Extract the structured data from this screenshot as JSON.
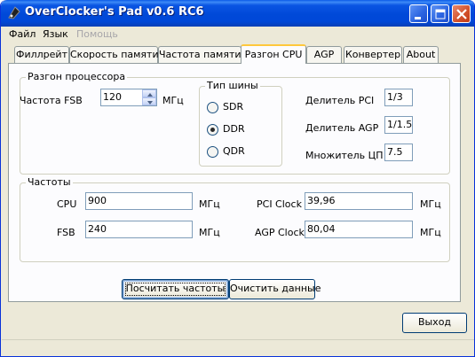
{
  "window": {
    "title": "OverClocker's Pad v0.6 RC6"
  },
  "menu": {
    "items": [
      "Файл",
      "Язык",
      "Помощь"
    ]
  },
  "tabs": [
    "Филлрейт",
    "Скорость памяти",
    "Частота памяти",
    "Разгон CPU",
    "AGP",
    "Конвертер",
    "About"
  ],
  "active_tab": "Разгон CPU",
  "overclock": {
    "group_title": "Разгон процессора",
    "fsb_label": "Частота FSB",
    "fsb_value": "120",
    "fsb_unit": "МГц",
    "bus_type": {
      "title": "Тип шины",
      "options": [
        "SDR",
        "DDR",
        "QDR"
      ],
      "selected": "DDR"
    },
    "pci_divider_label": "Делитель PCI",
    "pci_divider_value": "1/3",
    "agp_divider_label": "Делитель AGP",
    "agp_divider_value": "1/1.5",
    "cpu_multiplier_label": "Множитель ЦП",
    "cpu_multiplier_value": "7.5"
  },
  "frequencies": {
    "group_title": "Частоты",
    "cpu_label": "CPU",
    "cpu_value": "900",
    "fsb_label": "FSB",
    "fsb_value": "240",
    "pci_label": "PCI Clock",
    "pci_value": "39,96",
    "agp_label": "AGP Clock",
    "agp_value": "80,04",
    "unit": "МГц"
  },
  "buttons": {
    "calculate": "Посчитать частоты",
    "clear": "Очистить данные",
    "exit": "Выход"
  }
}
